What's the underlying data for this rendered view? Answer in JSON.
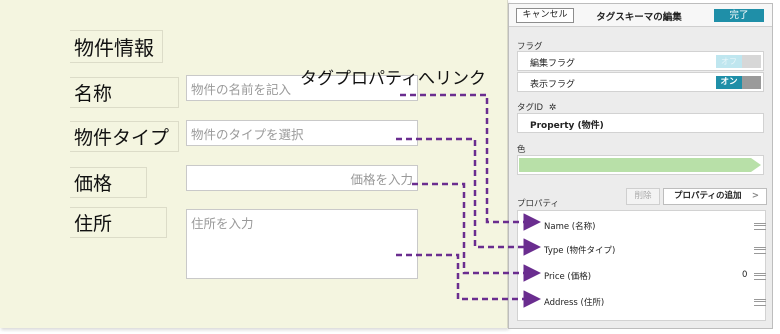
{
  "form": {
    "heading": "物件情報",
    "name_label": "名称",
    "name_placeholder": "物件の名前を記入",
    "type_label": "物件タイプ",
    "type_placeholder": "物件のタイプを選択",
    "price_label": "価格",
    "price_placeholder": "価格を入力",
    "address_label": "住所",
    "address_placeholder": "住所を入力"
  },
  "callout": "タグプロパティへリンク",
  "editor": {
    "cancel_label": "キャンセル",
    "title": "タグスキーマの編集",
    "done_label": "完了",
    "flags_section": "フラグ",
    "edit_flag_label": "編集フラグ",
    "edit_flag_state": "オフ",
    "display_flag_label": "表示フラグ",
    "display_flag_state": "オン",
    "tagid_section": "タグID",
    "tagid_value": "Property (物件)",
    "color_section": "色",
    "color_value": "#b8e0a8",
    "props_section": "プロパティ",
    "delete_label": "削除",
    "add_prop_label": "プロパティの追加",
    "properties": [
      {
        "name": "Name (名称)",
        "value": ""
      },
      {
        "name": "Type (物件タイプ)",
        "value": ""
      },
      {
        "name": "Price (価格)",
        "value": "0"
      },
      {
        "name": "Address (住所)",
        "value": ""
      }
    ]
  },
  "colors": {
    "accent": "#1f8fa8",
    "arrow": "#6a2d8f",
    "form_bg": "#f4f5e0"
  },
  "icons": {
    "gear": "gear-icon",
    "chevron": "chevron-right-icon"
  }
}
